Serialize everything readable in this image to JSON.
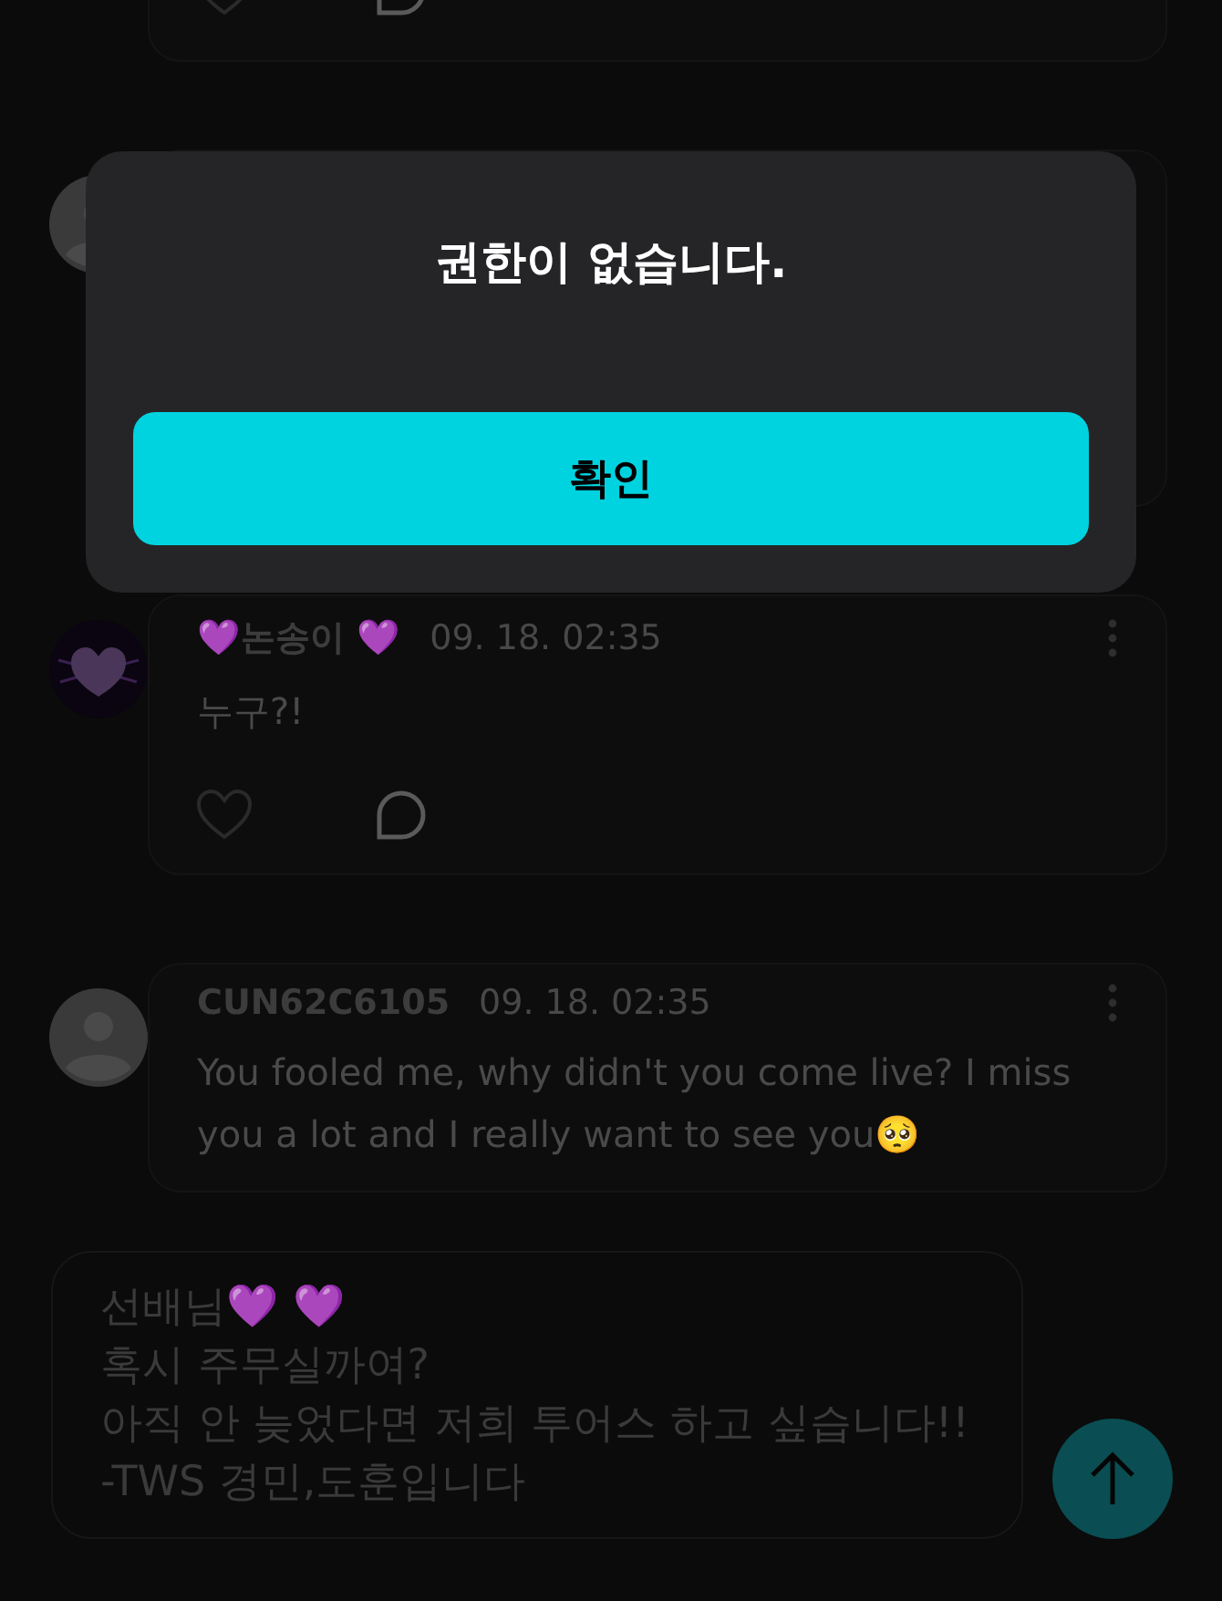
{
  "comments": [
    {
      "kind": "partial"
    },
    {
      "kind": "hidden",
      "avatar": {
        "kind": "default"
      }
    },
    {
      "kind": "full",
      "author": "💜논송이 💜",
      "time": "09. 18. 02:35",
      "text": "누구?!"
    },
    {
      "kind": "full",
      "avatar": {
        "kind": "default"
      },
      "author": "CUN62C6105",
      "time": "09. 18. 02:35",
      "text": "You fooled me, why didn't you come live? I miss you a lot and I really want to see you🥺"
    }
  ],
  "composer": {
    "value": "선배님💜 💜\n혹시 주무실까여?\n아직 안 늦었다면 저희 투어스 하고 싶습니다!!\n-TWS 경민,도훈입니다"
  },
  "dialog": {
    "message": "권한이 없습니다.",
    "button": "확인"
  }
}
